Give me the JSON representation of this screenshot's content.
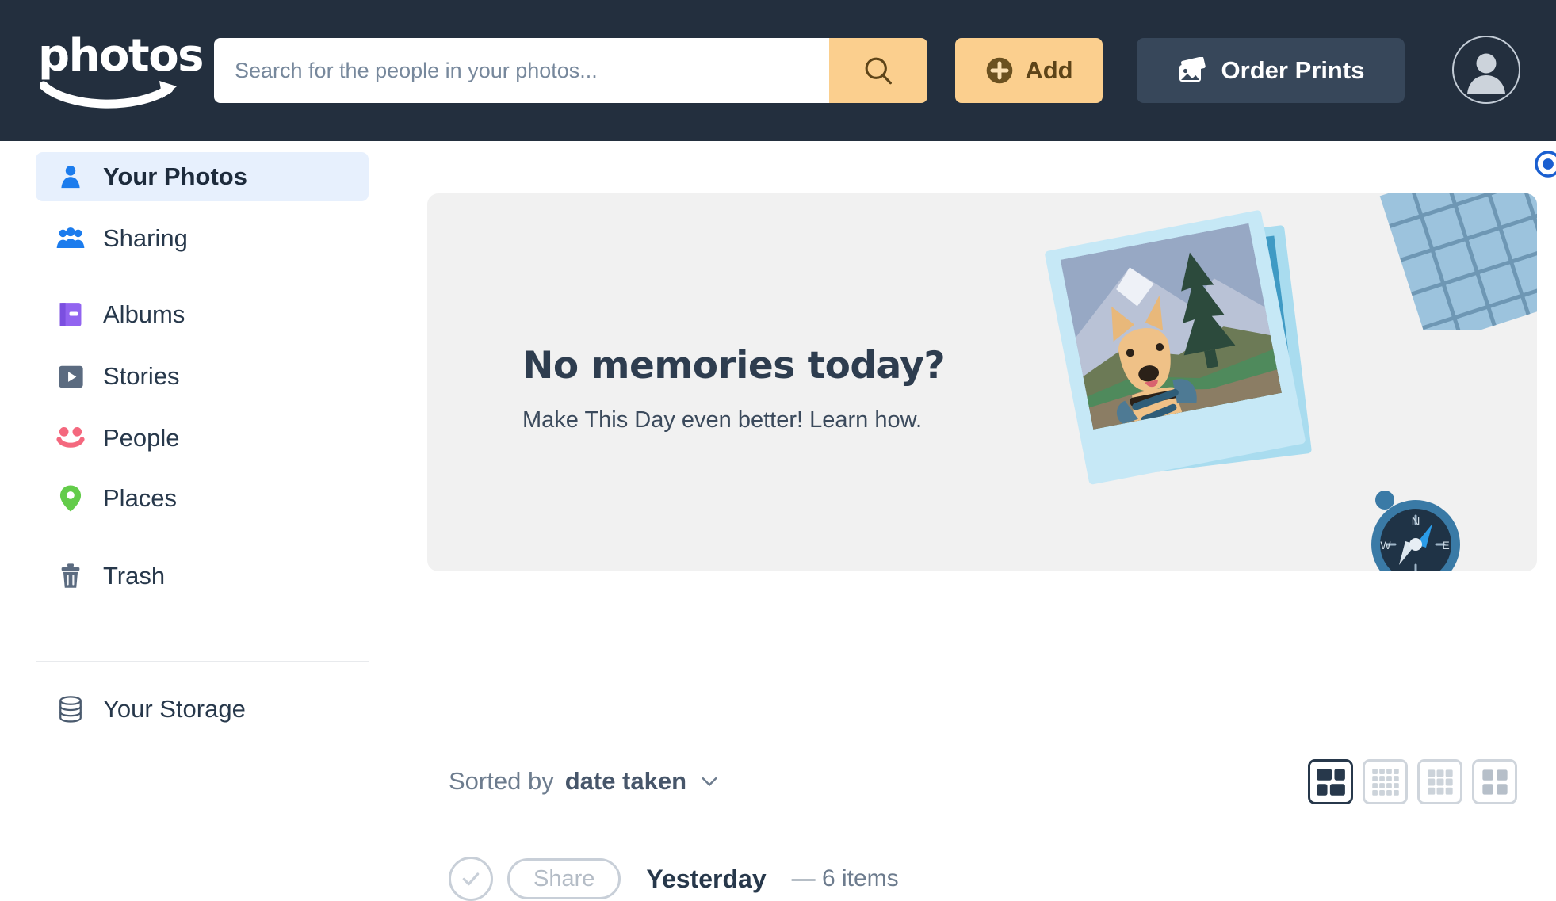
{
  "header": {
    "logo_text": "photos",
    "logo_icon": "amazon-smile-swoosh",
    "search": {
      "placeholder": "Search for the people in your photos...",
      "value": "",
      "button_icon": "search-icon"
    },
    "add_button": {
      "label": "Add",
      "icon": "plus-circle-icon"
    },
    "order_prints_button": {
      "label": "Order Prints",
      "icon": "photo-print-icon"
    },
    "avatar": {
      "icon": "user-avatar-icon"
    },
    "bg_color": "#232f3e",
    "accent_color": "#fbcf8e"
  },
  "sidebar": {
    "items": [
      {
        "label": "Your Photos",
        "icon": "person-icon",
        "color": "#1c7ced",
        "active": true
      },
      {
        "label": "Sharing",
        "icon": "people-icon",
        "color": "#1c7ced",
        "active": false
      },
      {
        "label": "Albums",
        "icon": "book-icon",
        "color": "#9264f0",
        "active": false
      },
      {
        "label": "Stories",
        "icon": "play-icon",
        "color": "#5b6b80",
        "active": false
      },
      {
        "label": "People",
        "icon": "smiley-icon",
        "color": "#f4687e",
        "active": false
      },
      {
        "label": "Places",
        "icon": "map-pin-icon",
        "color": "#63cc4a",
        "active": false
      },
      {
        "label": "Trash",
        "icon": "trash-icon",
        "color": "#5b6b80",
        "active": false
      },
      {
        "label": "Your Storage",
        "icon": "database-icon",
        "color": "#5b6b80",
        "active": false
      }
    ],
    "active_bg": "#e7f0fd"
  },
  "banner": {
    "title": "No memories today?",
    "subtitle": "Make This Day even better! Learn how.",
    "bg_color": "#f1f1f1",
    "art": {
      "polaroid": "polaroid-photo-dog-mountains",
      "contact_sheet": "film-contact-sheet-grid",
      "compass": "compass-icon"
    },
    "help_icon": "help-circle-icon"
  },
  "toolbar": {
    "sort_prefix": "Sorted by",
    "sort_value": "date taken",
    "sort_chevron": "chevron-down-icon",
    "views": [
      {
        "name": "mosaic-view",
        "icon": "mosaic-grid-icon",
        "selected": true
      },
      {
        "name": "dense-grid-view",
        "icon": "grid-4x4-icon",
        "selected": false
      },
      {
        "name": "medium-grid-view",
        "icon": "grid-3x3-icon",
        "selected": false
      },
      {
        "name": "large-grid-view",
        "icon": "grid-2x2-icon",
        "selected": false
      }
    ]
  },
  "group": {
    "select_icon": "check-circle-icon",
    "share_label": "Share",
    "day_label": "Yesterday",
    "meta": "— 6 items"
  }
}
